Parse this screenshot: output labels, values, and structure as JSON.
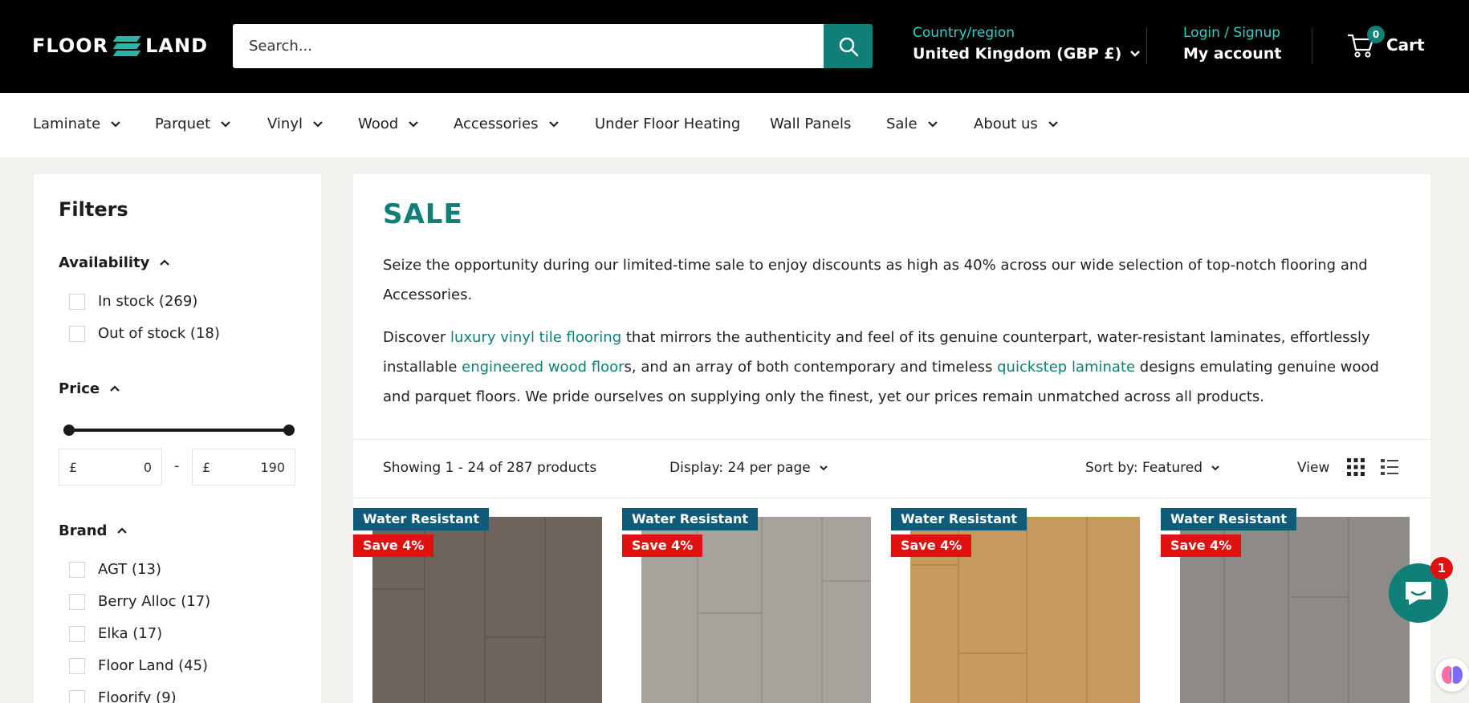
{
  "header": {
    "logo_left": "FLOOR",
    "logo_right": "LAND",
    "search_placeholder": "Search...",
    "country_label": "Country/region",
    "country_value": "United Kingdom (GBP £)",
    "login_label": "Login / Signup",
    "account_label": "My account",
    "cart_count": "0",
    "cart_label": "Cart"
  },
  "nav": {
    "items": [
      {
        "label": "Laminate"
      },
      {
        "label": "Parquet"
      },
      {
        "label": "Vinyl"
      },
      {
        "label": "Wood"
      },
      {
        "label": "Accessories"
      },
      {
        "label": "Under Floor Heating"
      },
      {
        "label": "Wall Panels"
      },
      {
        "label": "Sale"
      },
      {
        "label": "About us"
      }
    ]
  },
  "filters": {
    "title": "Filters",
    "availability": {
      "label": "Availability",
      "options": [
        {
          "label": "In stock (269)"
        },
        {
          "label": "Out of stock (18)"
        }
      ]
    },
    "price": {
      "label": "Price",
      "currency": "£",
      "min": "0",
      "max": "190",
      "separator": "-"
    },
    "brand": {
      "label": "Brand",
      "options": [
        {
          "label": "AGT (13)"
        },
        {
          "label": "Berry Alloc (17)"
        },
        {
          "label": "Elka (17)"
        },
        {
          "label": "Floor Land (45)"
        },
        {
          "label": "Floorify (9)"
        }
      ]
    }
  },
  "main": {
    "title": "SALE",
    "intro": "Seize the opportunity during our limited-time sale to enjoy discounts as high as 40% across our wide selection of top-notch flooring and Accessories.",
    "para2": {
      "t1": "Discover ",
      "link1": "luxury vinyl tile flooring",
      "t2": " that mirrors the authenticity and feel of its genuine counterpart, water-resistant laminates, effortlessly installable ",
      "link2": "engineered wood floor",
      "t3": "s, and an array of both contemporary and timeless ",
      "link3": "quickstep laminate",
      "t4": " designs emulating genuine wood and parquet floors. We pride ourselves on supplying only the finest, yet our prices remain unmatched across all products."
    },
    "toolbar": {
      "showing": "Showing 1 - 24 of 287 products",
      "display": "Display: 24 per page",
      "sort": "Sort by: Featured",
      "view": "View"
    }
  },
  "products": [
    {
      "badge1": "Water Resistant",
      "badge2": "Save 4%",
      "color": "#6e645c"
    },
    {
      "badge1": "Water Resistant",
      "badge2": "Save 4%",
      "color": "#a8a29c"
    },
    {
      "badge1": "Water Resistant",
      "badge2": "Save 4%",
      "color": "#c79a5e"
    },
    {
      "badge1": "Water Resistant",
      "badge2": "Save 4%",
      "color": "#8e8a87"
    }
  ],
  "chat": {
    "notification_count": "1"
  },
  "colors": {
    "accent": "#0f7f78",
    "accent_light": "#31d2c4",
    "sale_red": "#e21111",
    "badge_blue": "#105c78"
  }
}
